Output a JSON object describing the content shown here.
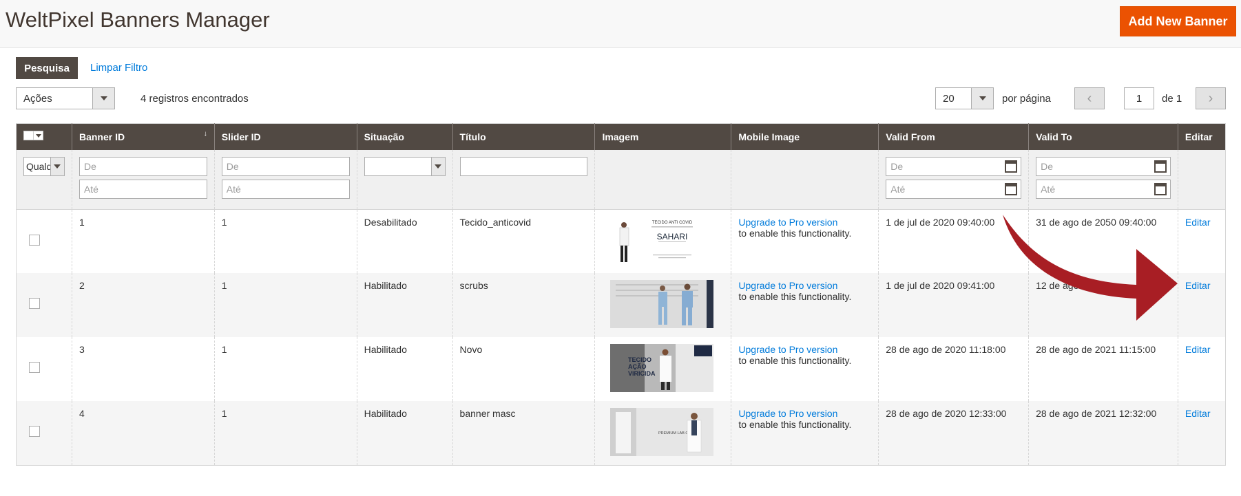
{
  "header": {
    "title": "WeltPixel Banners Manager",
    "add_button": "Add New Banner"
  },
  "toolbar": {
    "search_button": "Pesquisa",
    "clear_filter": "Limpar Filtro",
    "actions_select": "Ações",
    "records_found": "4 registros encontrados",
    "per_page_value": "20",
    "per_page_label": "por página",
    "current_page": "1",
    "page_of": "de 1",
    "prev_icon": "‹",
    "next_icon": "›"
  },
  "columns": {
    "banner_id": "Banner ID",
    "slider_id": "Slider ID",
    "status": "Situação",
    "title": "Título",
    "image": "Imagem",
    "mobile_image": "Mobile Image",
    "valid_from": "Valid From",
    "valid_to": "Valid To",
    "edit": "Editar",
    "sort_icon": "↓"
  },
  "filters": {
    "any_select": "Qualq",
    "from_placeholder": "De",
    "to_placeholder": "Até"
  },
  "rows": [
    {
      "banner_id": "1",
      "slider_id": "1",
      "status": "Desabilitado",
      "title": "Tecido_anticovid",
      "mobile_link": "Upgrade to Pro version",
      "mobile_text": "to enable this functionality.",
      "valid_from": "1 de jul de 2020 09:40:00",
      "valid_to": "31 de ago de 2050 09:40:00",
      "edit": "Editar"
    },
    {
      "banner_id": "2",
      "slider_id": "1",
      "status": "Habilitado",
      "title": "scrubs",
      "mobile_link": "Upgrade to Pro version",
      "mobile_text": "to enable this functionality.",
      "valid_from": "1 de jul de 2020 09:41:00",
      "valid_to": "12 de ago d",
      "edit": "Editar"
    },
    {
      "banner_id": "3",
      "slider_id": "1",
      "status": "Habilitado",
      "title": "Novo",
      "mobile_link": "Upgrade to Pro version",
      "mobile_text": "to enable this functionality.",
      "valid_from": "28 de ago de 2020 11:18:00",
      "valid_to": "28 de ago de 2021 11:15:00",
      "edit": "Editar"
    },
    {
      "banner_id": "4",
      "slider_id": "1",
      "status": "Habilitado",
      "title": "banner masc",
      "mobile_link": "Upgrade to Pro version",
      "mobile_text": "to enable this functionality.",
      "valid_from": "28 de ago de 2020 12:33:00",
      "valid_to": "28 de ago de 2021 12:32:00",
      "edit": "Editar"
    }
  ],
  "thumbnails": {
    "t1_line1": "TECIDO ANTI COVID",
    "t1_brand": "SAHARI",
    "t3_line1": "TECIDO",
    "t3_line2": "AÇÃO",
    "t3_line3": "VIRICIDA",
    "t4_text": "PREMIUM LAB COATS"
  },
  "colors": {
    "accent": "#eb5202",
    "header_bg": "#514943",
    "link": "#007bdb",
    "annotation_arrow": "#a81e24"
  }
}
